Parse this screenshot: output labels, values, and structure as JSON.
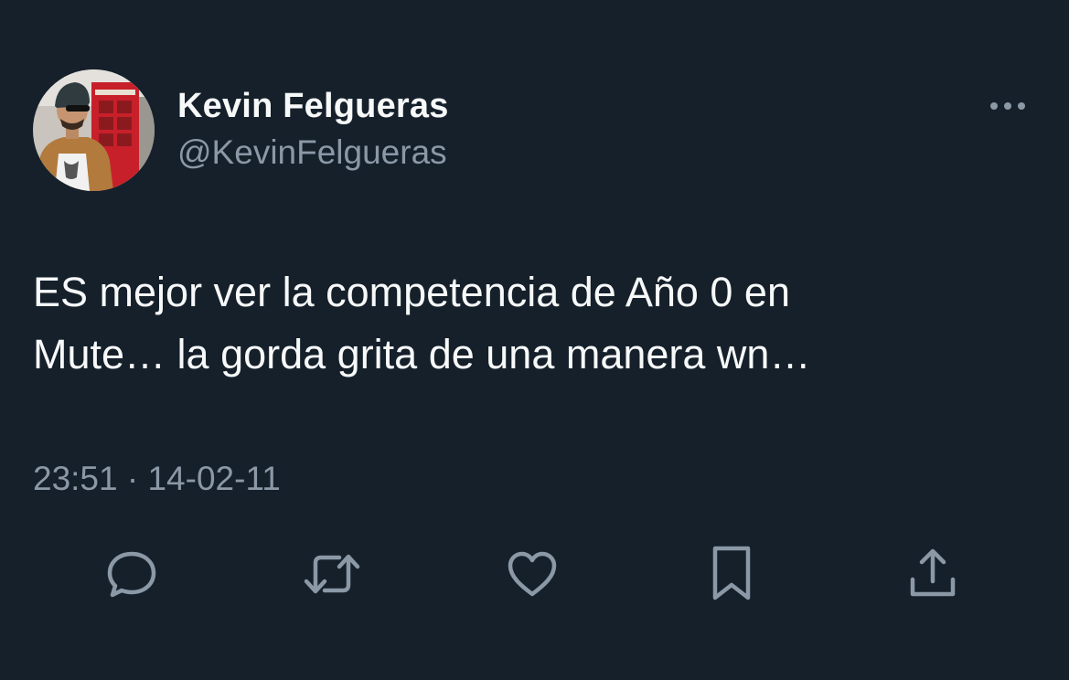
{
  "author": {
    "display_name": "Kevin Felgueras",
    "handle": "@KevinFelgueras"
  },
  "tweet": {
    "text": "ES mejor ver la competencia de Año 0 en\nMute… la gorda grita de una manera wn…",
    "time": "23:51",
    "separator": "·",
    "date": "14-02-11"
  },
  "icons": {
    "more": "more-horizontal-icon",
    "reply": "reply-bubble-icon",
    "retweet": "retweet-arrows-icon",
    "like": "heart-icon",
    "bookmark": "bookmark-icon",
    "share": "share-upload-icon"
  },
  "colors": {
    "background": "#15202b",
    "primary_text": "#f7f9f9",
    "secondary_text": "#8b98a5",
    "icon": "#8b98a5"
  }
}
